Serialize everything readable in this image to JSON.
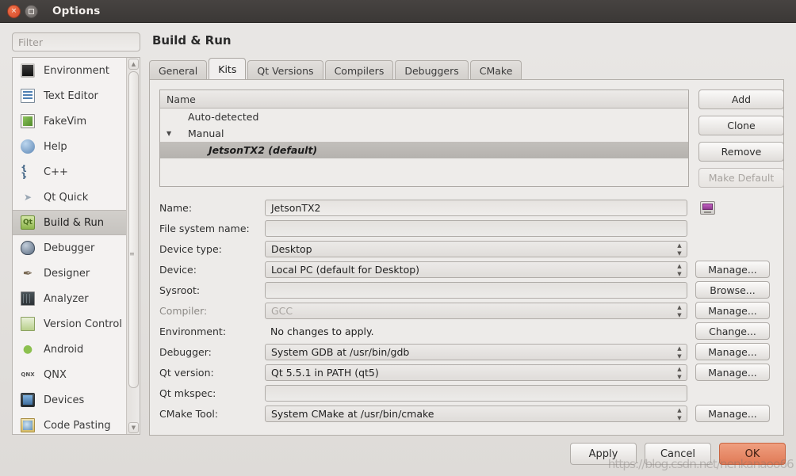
{
  "window": {
    "title": "Options",
    "close_label": "×",
    "maximize_label": ""
  },
  "filter": {
    "placeholder": "Filter",
    "value": ""
  },
  "sidebar": {
    "items": [
      {
        "label": "Environment",
        "icon": "environment-icon",
        "selected": false
      },
      {
        "label": "Text Editor",
        "icon": "text-editor-icon",
        "selected": false
      },
      {
        "label": "FakeVim",
        "icon": "fakevim-icon",
        "selected": false
      },
      {
        "label": "Help",
        "icon": "help-icon",
        "selected": false
      },
      {
        "label": "C++",
        "icon": "cpp-icon",
        "selected": false
      },
      {
        "label": "Qt Quick",
        "icon": "qt-quick-icon",
        "selected": false
      },
      {
        "label": "Build & Run",
        "icon": "build-and-run-icon",
        "selected": true
      },
      {
        "label": "Debugger",
        "icon": "debugger-icon",
        "selected": false
      },
      {
        "label": "Designer",
        "icon": "designer-icon",
        "selected": false
      },
      {
        "label": "Analyzer",
        "icon": "analyzer-icon",
        "selected": false
      },
      {
        "label": "Version Control",
        "icon": "version-control-icon",
        "selected": false
      },
      {
        "label": "Android",
        "icon": "android-icon",
        "selected": false
      },
      {
        "label": "QNX",
        "icon": "qnx-icon",
        "selected": false
      },
      {
        "label": "Devices",
        "icon": "devices-icon",
        "selected": false
      },
      {
        "label": "Code Pasting",
        "icon": "code-pasting-icon",
        "selected": false
      }
    ]
  },
  "page": {
    "title": "Build & Run",
    "tabs": [
      {
        "label": "General",
        "active": false
      },
      {
        "label": "Kits",
        "active": true
      },
      {
        "label": "Qt Versions",
        "active": false
      },
      {
        "label": "Compilers",
        "active": false
      },
      {
        "label": "Debuggers",
        "active": false
      },
      {
        "label": "CMake",
        "active": false
      }
    ]
  },
  "kits_tree": {
    "column_header": "Name",
    "rows": [
      {
        "label": "Auto-detected",
        "level": 1,
        "expander": "",
        "selected": false
      },
      {
        "label": "Manual",
        "level": 1,
        "expander": "▼",
        "selected": false
      },
      {
        "label": "JetsonTX2 (default)",
        "level": 2,
        "expander": "",
        "selected": true
      }
    ]
  },
  "kit_buttons": [
    {
      "label": "Add",
      "enabled": true
    },
    {
      "label": "Clone",
      "enabled": true
    },
    {
      "label": "Remove",
      "enabled": true
    },
    {
      "label": "Make Default",
      "enabled": false
    }
  ],
  "form": {
    "rows": [
      {
        "label": "Name:",
        "type": "text",
        "value": "JetsonTX2",
        "enabled": true,
        "tail": "device-icon",
        "tail_label": ""
      },
      {
        "label": "File system name:",
        "type": "text",
        "value": "",
        "enabled": true,
        "tail": "none",
        "tail_label": ""
      },
      {
        "label": "Device type:",
        "type": "combo",
        "value": "Desktop",
        "enabled": true,
        "tail": "none",
        "tail_label": ""
      },
      {
        "label": "Device:",
        "type": "combo",
        "value": "Local PC (default for Desktop)",
        "enabled": true,
        "tail": "button",
        "tail_label": "Manage..."
      },
      {
        "label": "Sysroot:",
        "type": "text",
        "value": "",
        "enabled": true,
        "tail": "button",
        "tail_label": "Browse..."
      },
      {
        "label": "Compiler:",
        "type": "combo",
        "value": "GCC",
        "enabled": false,
        "tail": "button",
        "tail_label": "Manage..."
      },
      {
        "label": "Environment:",
        "type": "static",
        "value": "No changes to apply.",
        "enabled": true,
        "tail": "button",
        "tail_label": "Change..."
      },
      {
        "label": "Debugger:",
        "type": "combo",
        "value": "System GDB at /usr/bin/gdb",
        "enabled": true,
        "tail": "button",
        "tail_label": "Manage..."
      },
      {
        "label": "Qt version:",
        "type": "combo",
        "value": "Qt 5.5.1 in PATH (qt5)",
        "enabled": true,
        "tail": "button",
        "tail_label": "Manage..."
      },
      {
        "label": "Qt mkspec:",
        "type": "text",
        "value": "",
        "enabled": true,
        "tail": "none",
        "tail_label": ""
      },
      {
        "label": "CMake Tool:",
        "type": "combo",
        "value": "System CMake at /usr/bin/cmake",
        "enabled": true,
        "tail": "button",
        "tail_label": "Manage..."
      }
    ]
  },
  "dialog_buttons": [
    {
      "label": "Apply",
      "primary": false
    },
    {
      "label": "Cancel",
      "primary": false
    },
    {
      "label": "OK",
      "primary": true
    }
  ],
  "watermark": {
    "text": "https://blog.csdn.net/nenkanaoo66"
  },
  "colors": {
    "titlebar": "#3f3b39",
    "close_button": "#e0532c",
    "ok_button": "#e58160",
    "selection": "#bcb9b5",
    "panel": "#edebe9"
  }
}
